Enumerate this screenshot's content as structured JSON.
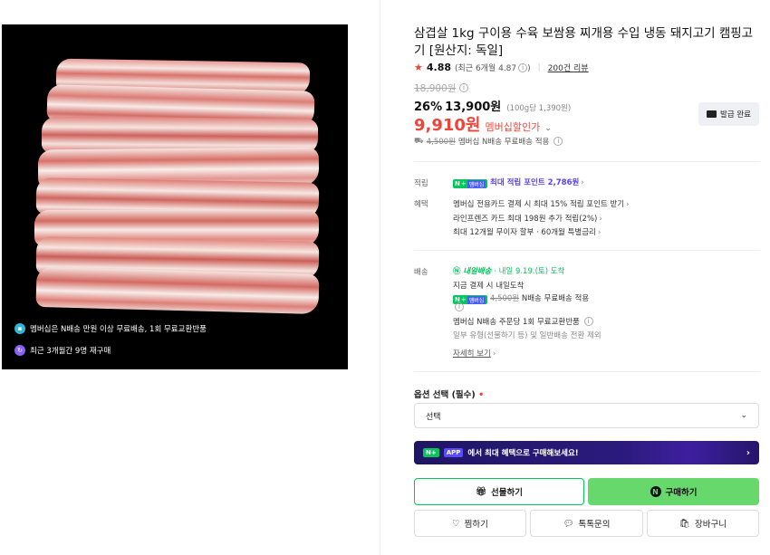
{
  "product": {
    "title": "삼겹살 1kg 구이용 수육 보쌈용 찌개용 수입 냉동 돼지고기 캠핑고기 [원산지: 독일]",
    "rating": {
      "star": "★",
      "score": "4.88",
      "recent": "(최근 6개월 4.87",
      "recent_close": ")",
      "reviews": "200건 리뷰"
    },
    "original_price": "18,900원",
    "discount_rate": "26%",
    "sale_price": "13,900원",
    "per_unit": "(100g당 1,390원)",
    "member_price": "9,910원",
    "member_label": "멤버십할인가",
    "coupon_label": "발급 완료",
    "shipping": {
      "fee_strike": "4,500원",
      "text": "멤버십 N배송 무료배송 적용"
    }
  },
  "image_badges": {
    "delivery": "멤버십은 N배송 만원 이상 무료배송, 1회 무료교환반품",
    "rebuy": "최근 3개월간 9명 재구매"
  },
  "benefits": {
    "points_label": "적립",
    "points_text": "최대 적립 포인트 2,786원",
    "benefit_label": "혜택",
    "lines": [
      "멤버십 전용카드 결제 시 최대 15% 적립 포인트 받기",
      "라인프렌즈 카드 최대 198원 추가 적립(2%)",
      "최대 12개월 무이자 할부 · 60개월 특별금리"
    ]
  },
  "delivery": {
    "label": "배송",
    "tomorrow": "내일배송",
    "date": "· 내일 9.19.(토) 도착",
    "pay_now": "지금 결제 시 내일도착",
    "fee_strike": "4,500원",
    "fee_text": "N배송 무료배송 적용",
    "exchange": "멤버십 N배송 주문당 1회 무료교환반품",
    "exclude": "일부 유형(선물하기 등) 및 일반배송 전환 제외",
    "more": "자세히 보기"
  },
  "npay_badge": {
    "n": "N",
    "plus": "+",
    "mem": "멤버십"
  },
  "options": {
    "label": "옵션 선택 (필수)",
    "required_mark": "•",
    "select_value": "선택"
  },
  "app_banner": {
    "tag1": "N+",
    "tag2": "APP",
    "text": "에서 최대 혜택으로 구매해보세요!"
  },
  "buttons": {
    "gift": "선물하기",
    "buy": "구매하기",
    "wish": "찜하기",
    "talk": "톡톡문의",
    "cart": "장바구니"
  },
  "colors": {
    "accent_red": "#f0443a",
    "naver_green": "#03c75a",
    "buy_button": "#67d86c",
    "points_purple": "#5b3df6"
  }
}
